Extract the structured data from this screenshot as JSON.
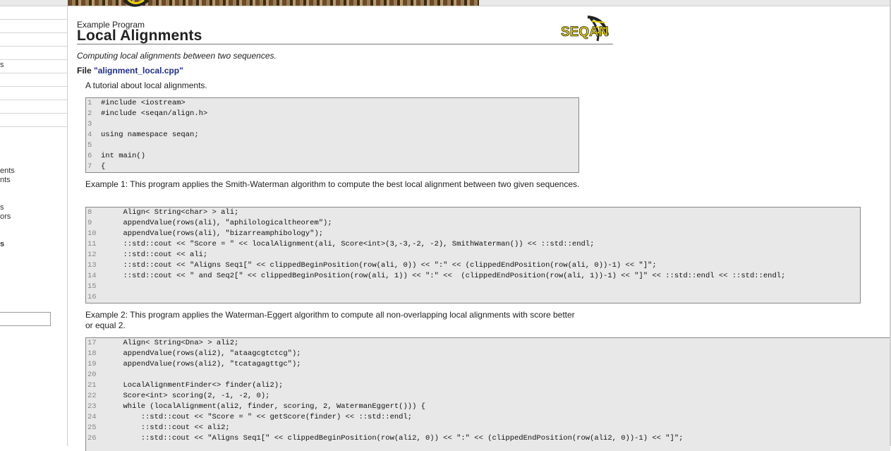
{
  "header": {
    "eyebrow": "Example Program",
    "title": "Local Alignments",
    "logo_text": "SEQAN"
  },
  "sidebar": {
    "partial_items": [
      {
        "label": "s",
        "bold": false
      },
      {
        "label": "ents",
        "bold": false
      },
      {
        "label": "nts",
        "bold": false
      },
      {
        "label": "s",
        "bold": false
      },
      {
        "label": "ors",
        "bold": false
      },
      {
        "label": "s",
        "bold": true
      }
    ]
  },
  "content": {
    "subtitle": "Computing local alignments between two sequences.",
    "file_prefix": "File ",
    "file_name": "\"alignment_local.cpp\"",
    "intro": "A tutorial about local alignments.",
    "example1": "Example 1: This program applies the Smith-Waterman algorithm to compute the best local alignment between two given sequences.",
    "example2": "Example 2: This program applies the Waterman-Eggert algorithm to compute all non-overlapping local alignments with score better or equal 2."
  },
  "code_blocks": [
    {
      "lines": [
        {
          "n": "1",
          "code": "#include <iostream>"
        },
        {
          "n": "2",
          "code": "#include <seqan/align.h>"
        },
        {
          "n": "3",
          "code": ""
        },
        {
          "n": "4",
          "code": "using namespace seqan;"
        },
        {
          "n": "5",
          "code": ""
        },
        {
          "n": "6",
          "code": "int main()"
        },
        {
          "n": "7",
          "code": "{"
        }
      ]
    },
    {
      "lines": [
        {
          "n": "8",
          "code": "     Align< String<char> > ali;"
        },
        {
          "n": "9",
          "code": "     appendValue(rows(ali), \"aphilologicaltheorem\");"
        },
        {
          "n": "10",
          "code": "     appendValue(rows(ali), \"bizarreamphibology\");"
        },
        {
          "n": "11",
          "code": "     ::std::cout << \"Score = \" << localAlignment(ali, Score<int>(3,-3,-2, -2), SmithWaterman()) << ::std::endl;"
        },
        {
          "n": "12",
          "code": "     ::std::cout << ali;"
        },
        {
          "n": "13",
          "code": "     ::std::cout << \"Aligns Seq1[\" << clippedBeginPosition(row(ali, 0)) << \":\" << (clippedEndPosition(row(ali, 0))-1) << \"]\";"
        },
        {
          "n": "14",
          "code": "     ::std::cout << \" and Seq2[\" << clippedBeginPosition(row(ali, 1)) << \":\" <<  (clippedEndPosition(row(ali, 1))-1) << \"]\" << ::std::endl << ::std::endl;"
        },
        {
          "n": "15",
          "code": ""
        },
        {
          "n": "16",
          "code": ""
        }
      ]
    },
    {
      "lines": [
        {
          "n": "17",
          "code": "     Align< String<Dna> > ali2;"
        },
        {
          "n": "18",
          "code": "     appendValue(rows(ali2), \"ataagcgtctcg\");"
        },
        {
          "n": "19",
          "code": "     appendValue(rows(ali2), \"tcatagagttgc\");"
        },
        {
          "n": "20",
          "code": ""
        },
        {
          "n": "21",
          "code": "     LocalAlignmentFinder<> finder(ali2);"
        },
        {
          "n": "22",
          "code": "     Score<int> scoring(2, -1, -2, 0);"
        },
        {
          "n": "23",
          "code": "     while (localAlignment(ali2, finder, scoring, 2, WatermanEggert())) {"
        },
        {
          "n": "24",
          "code": "         ::std::cout << \"Score = \" << getScore(finder) << ::std::endl;"
        },
        {
          "n": "25",
          "code": "         ::std::cout << ali2;"
        },
        {
          "n": "26",
          "code": "         ::std::cout << \"Aligns Seq1[\" << clippedBeginPosition(row(ali2, 0)) << \":\" << (clippedEndPosition(row(ali2, 0))-1) << \"]\";"
        }
      ]
    }
  ]
}
